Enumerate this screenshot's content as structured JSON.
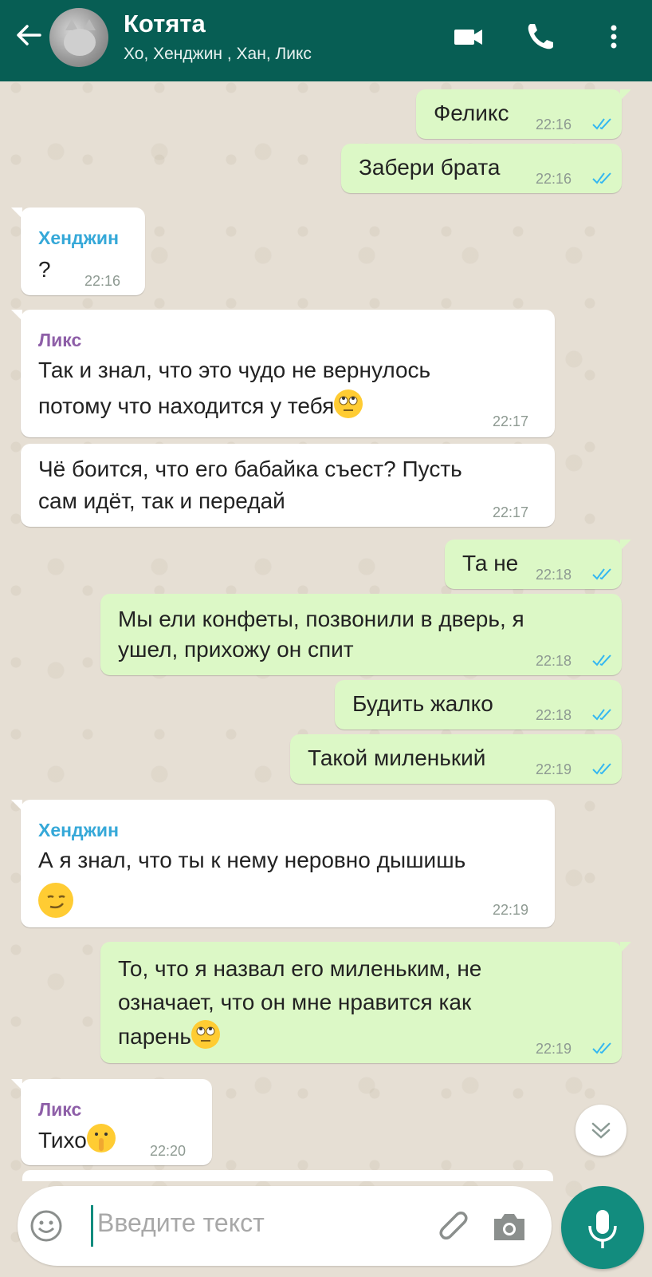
{
  "header": {
    "title": "Котята",
    "subtitle": "Хо, Хенджин , Хан, Ликс"
  },
  "messages": [
    {
      "dir": "out",
      "text": "Феликс",
      "time": "22:16"
    },
    {
      "dir": "out",
      "text": "Забери брата",
      "time": "22:16"
    },
    {
      "dir": "in",
      "sender": "Хенджин",
      "text": "?",
      "time": "22:16"
    },
    {
      "dir": "in",
      "sender": "Ликс",
      "text1": "Так и знал, что это чудо не вернулось",
      "text2": "потому что находится у тебя",
      "time": "22:17"
    },
    {
      "dir": "in",
      "text1": "Чё боится, что его бабайка съест? Пусть",
      "text2": "сам идёт, так и передай",
      "time": "22:17"
    },
    {
      "dir": "out",
      "text": "Та не",
      "time": "22:18"
    },
    {
      "dir": "out",
      "text1": "Мы ели конфеты, позвонили в дверь, я",
      "text2": "ушел, прихожу он спит",
      "time": "22:18"
    },
    {
      "dir": "out",
      "text": "Будить жалко",
      "time": "22:18"
    },
    {
      "dir": "out",
      "text": "Такой миленький",
      "time": "22:19"
    },
    {
      "dir": "in",
      "sender": "Хенджин",
      "text1": "А я знал, что ты к нему неровно дышишь",
      "time": "22:19"
    },
    {
      "dir": "out",
      "text1": "То, что я назвал его миленьким, не",
      "text2": "означает, что он мне нравится как",
      "text3": "парень",
      "time": "22:19"
    },
    {
      "dir": "in",
      "sender": "Ликс",
      "text": "Тихо",
      "time": "22:20"
    }
  ],
  "input": {
    "placeholder": "Введите текст"
  },
  "colors": {
    "header": "#075e54",
    "outgoing_bubble": "#dcf8c6",
    "incoming_bubble": "#ffffff",
    "sender_hendzhin": "#35a8d8",
    "sender_liks": "#8e5fa8",
    "read_ticks": "#34b7f1",
    "fab": "#128c7e"
  },
  "icons": {
    "back": "arrow-left-icon",
    "video": "video-camera-icon",
    "call": "phone-icon",
    "menu": "more-vertical-icon",
    "emoji": "smiley-icon",
    "attach": "paperclip-icon",
    "camera": "camera-icon",
    "mic": "microphone-icon",
    "scroll": "chevron-double-down-icon"
  }
}
